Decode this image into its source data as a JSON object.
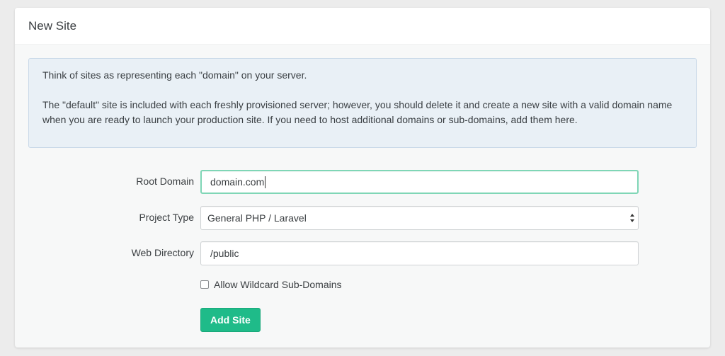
{
  "panel": {
    "title": "New Site"
  },
  "info": {
    "paragraph1": "Think of sites as representing each \"domain\" on your server.",
    "paragraph2": "The \"default\" site is included with each freshly provisioned server; however, you should delete it and create a new site with a valid domain name when you are ready to launch your production site. If you need to host additional domains or sub-domains, add them here."
  },
  "form": {
    "root_domain": {
      "label": "Root Domain",
      "value": "domain.com"
    },
    "project_type": {
      "label": "Project Type",
      "value": "General PHP / Laravel"
    },
    "web_directory": {
      "label": "Web Directory",
      "value": "/public"
    },
    "wildcard": {
      "label": "Allow Wildcard Sub-Domains",
      "checked": false
    },
    "submit_label": "Add Site"
  },
  "icons": {
    "select_arrows": "up-down-chevron-icon"
  },
  "colors": {
    "accent": "#1fbb89",
    "focus_border": "#7fd6b6",
    "info_bg": "#e9f0f6"
  }
}
